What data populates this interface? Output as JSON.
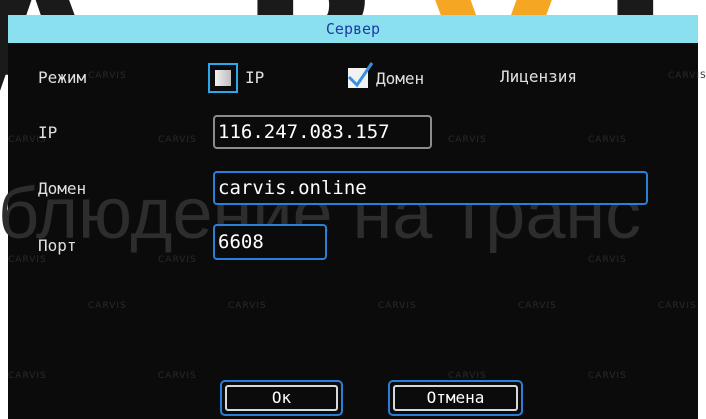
{
  "dialog": {
    "title": "Сервер"
  },
  "mode": {
    "label": "Режим",
    "option_ip": "IP",
    "option_domain": "Домен",
    "license": "Лицензия"
  },
  "fields": {
    "ip_label": "IP",
    "ip_value": "116.247.083.157",
    "domain_label": "Домен",
    "domain_value": "carvis.online",
    "port_label": "Порт",
    "port_value": "6608"
  },
  "buttons": {
    "ok": "Ок",
    "cancel": "Отмена"
  },
  "colors": {
    "title_bar": "#8ae0ee",
    "title_text": "#1d3aa8",
    "focus_border": "#29a8ee",
    "field_border": "#2a7fd9",
    "watermark": "#f5a623"
  }
}
